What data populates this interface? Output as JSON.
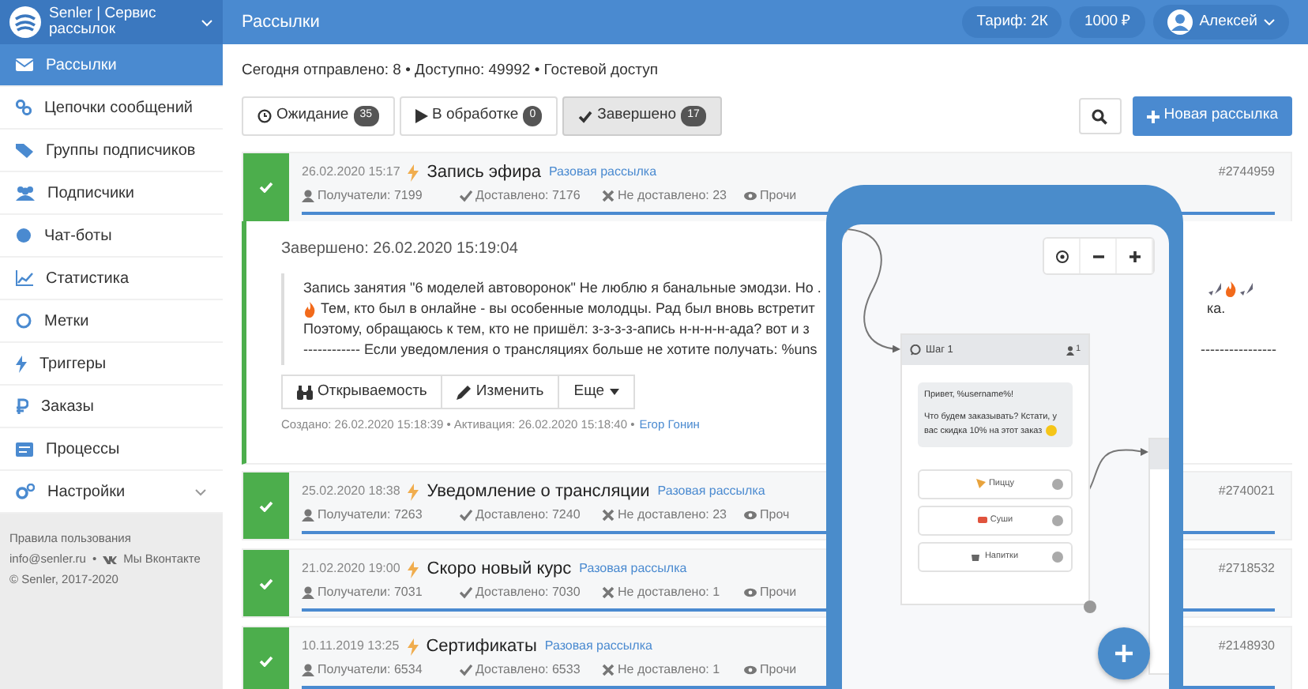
{
  "brand": {
    "title": "Senler | Сервис рассылок"
  },
  "sidebar": {
    "items": [
      {
        "label": "Рассылки",
        "selected": true,
        "submenu": false
      },
      {
        "label": "Цепочки сообщений",
        "selected": false,
        "submenu": false
      },
      {
        "label": "Группы подписчиков",
        "selected": false,
        "submenu": false
      },
      {
        "label": "Подписчики",
        "selected": false,
        "submenu": false
      },
      {
        "label": "Чат-боты",
        "selected": false,
        "submenu": false
      },
      {
        "label": "Статистика",
        "selected": false,
        "submenu": false
      },
      {
        "label": "Метки",
        "selected": false,
        "submenu": false
      },
      {
        "label": "Триггеры",
        "selected": false,
        "submenu": false
      },
      {
        "label": "Заказы",
        "selected": false,
        "submenu": false
      },
      {
        "label": "Процессы",
        "selected": false,
        "submenu": false
      },
      {
        "label": "Настройки",
        "selected": false,
        "submenu": true
      }
    ],
    "footer": {
      "terms": "Правила пользования",
      "email": "info@senler.ru",
      "separator": "•",
      "vk": "Мы Вконтакте",
      "copyright": "© Senler, 2017-2020"
    }
  },
  "header": {
    "title": "Рассылки",
    "tariff": "Тариф: 2К",
    "balance": "1000 ₽",
    "user": "Алексей"
  },
  "summary": "Сегодня отправлено: 8 • Доступно: 49992 • Гостевой доступ",
  "tabs": [
    {
      "label": "Ожидание",
      "count": "35",
      "selected": false
    },
    {
      "label": "В обработке",
      "count": "0",
      "selected": false
    },
    {
      "label": "Завершено",
      "count": "17",
      "selected": true
    }
  ],
  "new_button": "Новая рассылка",
  "mailings": [
    {
      "date": "26.02.2020 15:17",
      "title": "Запись эфира",
      "type": "Разовая рассылка",
      "number": "#2744959",
      "recipients": "Получатели: 7199",
      "delivered": "Доставлено: 7176",
      "not_delivered": "Не доставлено: 23",
      "read": "Прочи",
      "expanded": true,
      "detail": {
        "completed": "Завершено: 26.02.2020 15:19:04",
        "lines": [
          {
            "text": "Запись занятия \"6 моделей автоворонок\" Не люблю я банальные эмодзи. Но ."
          },
          {
            "text": "Тем, кто был в онлайне - вы особенные молодцы. Рад был вновь встретит",
            "tail": "ка."
          },
          {
            "text": "Поэтому, обращаюсь к тем, кто не пришёл: з-з-з-з-апись н-н-н-н-ада? вот и з"
          },
          {
            "text": "------------ Если уведомления о трансляциях больше не хотите получать: %uns",
            "tail": "----------------"
          }
        ],
        "actions": [
          "Открываемость",
          "Изменить",
          "Еще"
        ],
        "created": "Создано: 26.02.2020 15:18:39 • Активация: 26.02.2020 15:18:40 •",
        "author": "Егор Гонин"
      }
    },
    {
      "date": "25.02.2020 18:38",
      "title": "Уведомление о трансляции",
      "type": "Разовая рассылка",
      "number": "#2740021",
      "recipients": "Получатели: 7263",
      "delivered": "Доставлено: 7240",
      "not_delivered": "Не доставлено: 23",
      "read": "Проч",
      "expanded": false
    },
    {
      "date": "21.02.2020 19:00",
      "title": "Скоро новый курс",
      "type": "Разовая рассылка",
      "number": "#2718532",
      "recipients": "Получатели: 7031",
      "delivered": "Доставлено: 7030",
      "not_delivered": "Не доставлено: 1",
      "read": "Прочи",
      "expanded": false
    },
    {
      "date": "10.11.2019 13:25",
      "title": "Сертификаты",
      "type": "Разовая рассылка",
      "number": "#2148930",
      "recipients": "Получатели: 6534",
      "delivered": "Доставлено: 6533",
      "not_delivered": "Не доставлено: 1",
      "read": "Прочи",
      "expanded": false
    }
  ],
  "phone": {
    "step_title": "Шаг 1",
    "step_count": "1",
    "message": [
      "Привет, %username%!",
      "Что будем заказывать? Кстати, у вас скидка 10% на этот заказ"
    ],
    "buttons": [
      "Пиццу",
      "Суши",
      "Напитки"
    ]
  }
}
